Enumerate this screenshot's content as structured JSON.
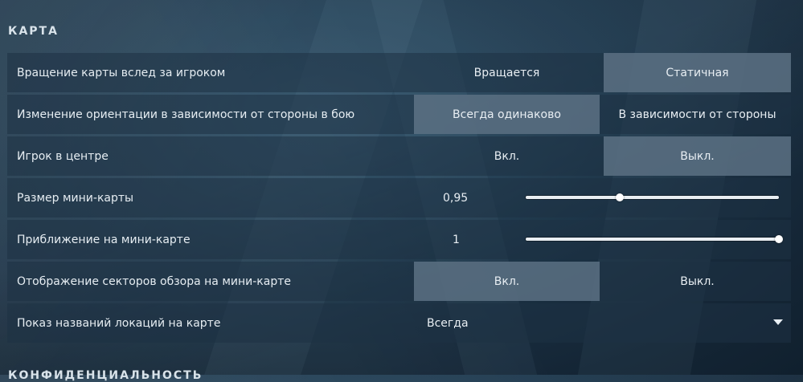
{
  "sections": {
    "map_title": "КАРТА",
    "next_title": "КОНФИДЕНЦИАЛЬНОСТЬ"
  },
  "settings": {
    "map_rotation": {
      "label": "Вращение карты вслед за игроком",
      "options": [
        "Вращается",
        "Статичная"
      ],
      "selected": "Статичная"
    },
    "orientation_change": {
      "label": "Изменение ориентации в зависимости от стороны в бою",
      "options": [
        "Всегда одинаково",
        "В зависимости от стороны"
      ],
      "selected": "Всегда одинаково"
    },
    "player_centered": {
      "label": "Игрок в центре",
      "options": [
        "Вкл.",
        "Выкл."
      ],
      "selected": "Выкл."
    },
    "minimap_size": {
      "label": "Размер мини-карты",
      "value_text": "0,95",
      "fraction": 0.37
    },
    "minimap_zoom": {
      "label": "Приближение на мини-карте",
      "value_text": "1",
      "fraction": 1.0
    },
    "view_sectors": {
      "label": "Отображение секторов обзора на мини-карте",
      "options": [
        "Вкл.",
        "Выкл."
      ],
      "selected": "Вкл."
    },
    "location_names": {
      "label": "Показ названий локаций на карте",
      "value": "Всегда"
    }
  },
  "icons": {
    "dropdown_caret": "triangle-down-icon"
  }
}
